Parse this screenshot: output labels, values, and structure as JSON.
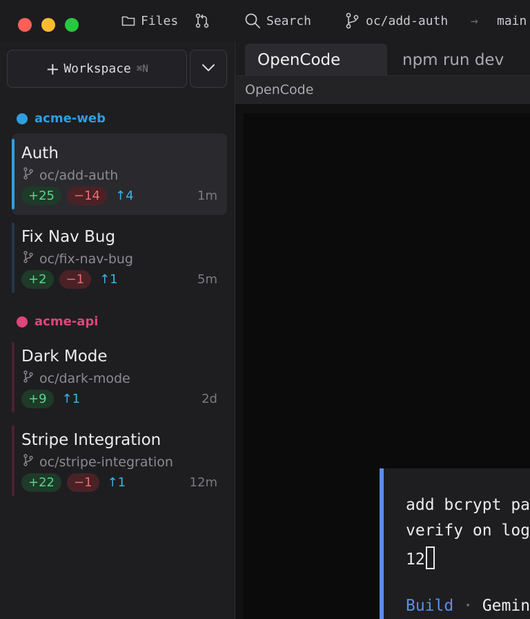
{
  "titlebar": {
    "files_label": "Files",
    "search_label": "Search",
    "branch": "oc/add-auth",
    "arrow": "→",
    "target_branch": "main"
  },
  "sidebar": {
    "workspace_button": {
      "label": "Workspace",
      "shortcut": "⌘N"
    },
    "groups": [
      {
        "name": "acme-web",
        "color": "#2f9fe0",
        "items": [
          {
            "title": "Auth",
            "branch": "oc/add-auth",
            "added": "+25",
            "removed": "−14",
            "ahead": "↑4",
            "age": "1m",
            "active": true,
            "bar_color": "#2f9fe0"
          },
          {
            "title": "Fix Nav Bug",
            "branch": "oc/fix-nav-bug",
            "added": "+2",
            "removed": "−1",
            "ahead": "↑1",
            "age": "5m",
            "active": false,
            "bar_color": "#23394a"
          }
        ]
      },
      {
        "name": "acme-api",
        "color": "#e0457b",
        "items": [
          {
            "title": "Dark Mode",
            "branch": "oc/dark-mode",
            "added": "+9",
            "ahead": "↑1",
            "age": "2d",
            "active": false,
            "bar_color": "#4a2230"
          },
          {
            "title": "Stripe Integration",
            "branch": "oc/stripe-integration",
            "added": "+22",
            "removed": "−1",
            "ahead": "↑1",
            "age": "12m",
            "active": false,
            "bar_color": "#4a2230"
          }
        ]
      }
    ]
  },
  "main": {
    "tabs": [
      {
        "label": "OpenCode",
        "active": true
      },
      {
        "label": "npm run dev",
        "active": false
      }
    ],
    "pane_title": "OpenCode",
    "prompt": {
      "lines": [
        "add bcrypt pas",
        "verify on logi",
        "12"
      ],
      "mode": "Build",
      "separator": "·",
      "model": "Gemini"
    }
  },
  "colors": {
    "accent": "#5b8def",
    "added": "#58d68d",
    "removed": "#ee6b6e",
    "ahead": "#38b6e8"
  }
}
